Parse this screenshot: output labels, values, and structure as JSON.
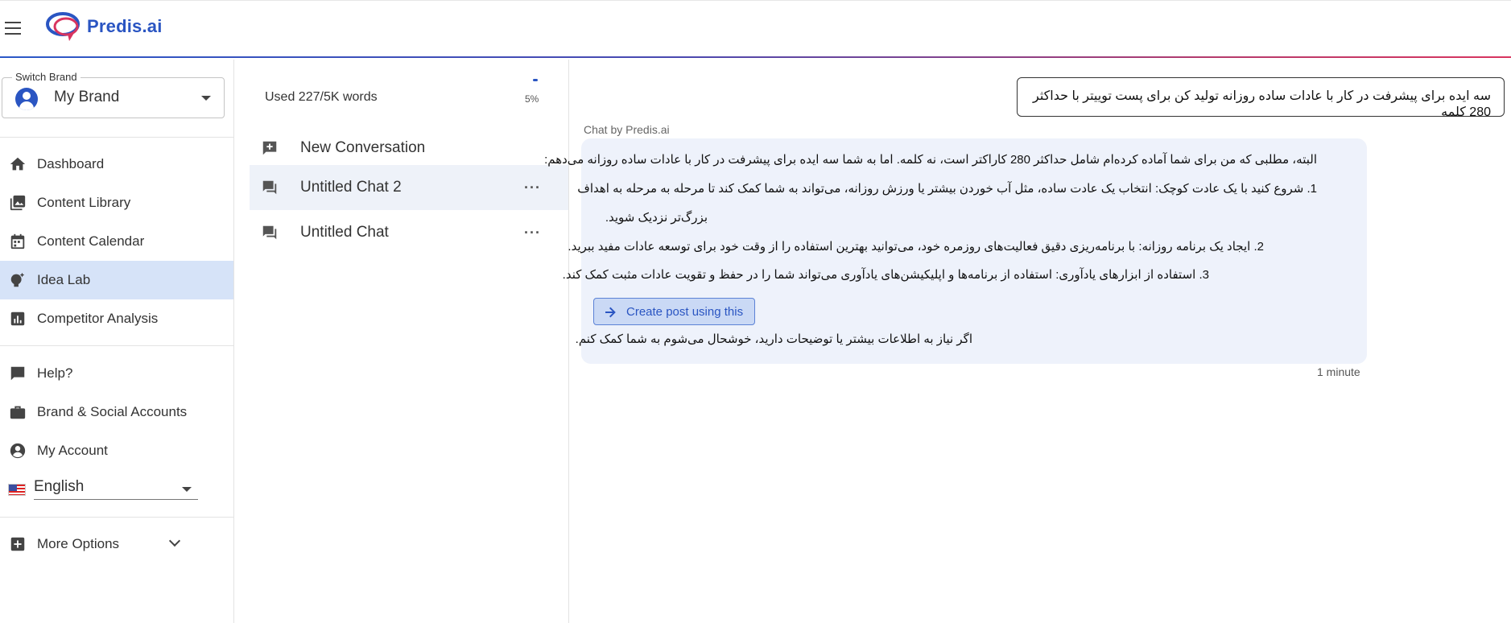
{
  "header": {
    "logo_text": "Predis.ai",
    "accent_color": "#2a55c2"
  },
  "sidebar": {
    "switch_brand_label": "Switch Brand",
    "brand_name": "My Brand",
    "nav_primary": [
      {
        "label": "Dashboard",
        "icon": "home-icon"
      },
      {
        "label": "Content Library",
        "icon": "image-library-icon"
      },
      {
        "label": "Content Calendar",
        "icon": "calendar-icon"
      },
      {
        "label": "Idea Lab",
        "icon": "lightbulb-icon",
        "active": true
      },
      {
        "label": "Competitor Analysis",
        "icon": "chart-icon"
      }
    ],
    "nav_secondary": [
      {
        "label": "Help?",
        "icon": "chat-bubble-icon"
      },
      {
        "label": "Brand & Social Accounts",
        "icon": "briefcase-icon"
      },
      {
        "label": "My Account",
        "icon": "account-icon"
      }
    ],
    "language": "English",
    "more_options": "More Options"
  },
  "conversations": {
    "usage_text": "Used 227/5K words",
    "usage_percent_label": "5%",
    "usage_percent": 5,
    "new_conversation": "New Conversation",
    "items": [
      {
        "title": "Untitled Chat 2",
        "active": true
      },
      {
        "title": "Untitled Chat",
        "active": false
      }
    ],
    "more_glyph": "···"
  },
  "chat": {
    "user_message": "سه ایده برای پیشرفت در کار با عادات ساده روزانه تولید کن برای پست توییتر با حداکثر 280 کلمه",
    "assistant_label": "Chat by Predis.ai",
    "response_lines": [
      "البته، مطلبی که من برای شما آماده کرده‌ام شامل حداکثر 280 کاراکتر است، نه کلمه. اما به شما سه ایده برای پیشرفت در کار با عادات ساده روزانه می‌دهم:",
      "1. شروع کنید با یک عادت کوچک: انتخاب یک عادت ساده، مثل آب خوردن بیشتر یا ورزش روزانه، می‌تواند به شما کمک کند تا مرحله به مرحله به اهداف",
      "بزرگ‌تر نزدیک شوید.",
      "2. ایجاد یک برنامه روزانه: با برنامه‌ریزی دقیق فعالیت‌های روزمره خود، می‌توانید بهترین استفاده را از وقت خود برای توسعه عادات مفید ببرید.",
      "3. استفاده از ابزارهای یادآوری: استفاده از برنامه‌ها و اپلیکیشن‌های یادآوری می‌تواند شما را در حفظ و تقویت عادات مثبت کمک کند."
    ],
    "create_post_label": "Create post using this",
    "closing_line": "اگر نیاز به اطلاعات بیشتر یا توضیحات دارید، خوشحال می‌شوم به شما کمک کنم.",
    "timestamp": "1 minute"
  }
}
